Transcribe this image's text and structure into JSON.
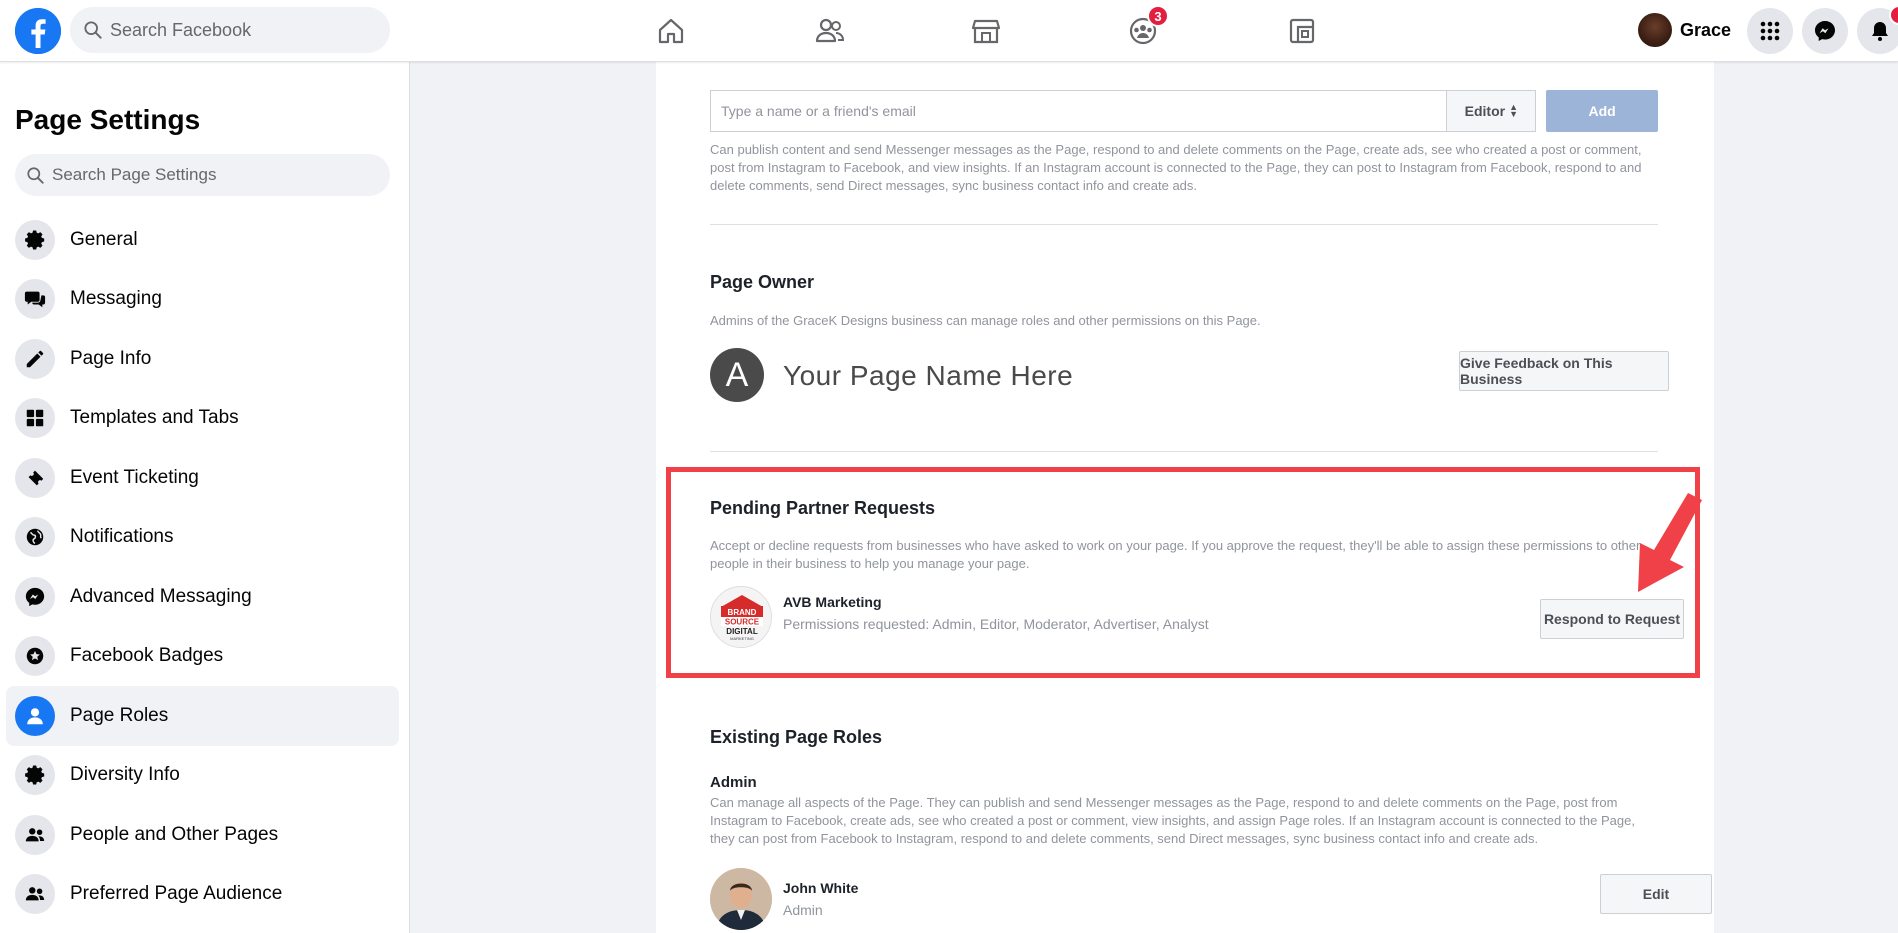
{
  "topbar": {
    "search_placeholder": "Search Facebook",
    "groups_badge": "3",
    "profile_name": "Grace"
  },
  "sidebar": {
    "title": "Page Settings",
    "search_placeholder": "Search Page Settings",
    "items": [
      {
        "label": "General",
        "icon": "gear-icon"
      },
      {
        "label": "Messaging",
        "icon": "chat-bubbles-icon"
      },
      {
        "label": "Page Info",
        "icon": "pencil-icon"
      },
      {
        "label": "Templates and Tabs",
        "icon": "grid-icon"
      },
      {
        "label": "Event Ticketing",
        "icon": "ticket-icon"
      },
      {
        "label": "Notifications",
        "icon": "globe-icon"
      },
      {
        "label": "Advanced Messaging",
        "icon": "messenger-icon"
      },
      {
        "label": "Facebook Badges",
        "icon": "star-badge-icon"
      },
      {
        "label": "Page Roles",
        "icon": "person-icon",
        "active": true
      },
      {
        "label": "Diversity Info",
        "icon": "gear-icon"
      },
      {
        "label": "People and Other Pages",
        "icon": "people-icon"
      },
      {
        "label": "Preferred Page Audience",
        "icon": "people-icon"
      }
    ]
  },
  "invite": {
    "placeholder": "Type a name or a friend's email",
    "role": "Editor",
    "add_label": "Add",
    "description": "Can publish content and send Messenger messages as the Page, respond to and delete comments on the Page, create ads, see who created a post or comment, post from Instagram to Facebook, and view insights. If an Instagram account is connected to the Page, they can post to Instagram from Facebook, respond to and delete comments, send Direct messages, sync business contact info and create ads."
  },
  "owner": {
    "title": "Page Owner",
    "description": "Admins of the GraceK Designs business can manage roles and other permissions on this Page.",
    "avatar_letter": "A",
    "page_name": "Your Page Name Here",
    "feedback_button": "Give Feedback on This Business"
  },
  "pending": {
    "title": "Pending Partner Requests",
    "description": "Accept or decline requests from businesses who have asked to work on your page. If you approve the request, they'll be able to assign these permissions to other people in their business to help you manage your page.",
    "partner_name": "AVB Marketing",
    "permissions": "Permissions requested: Admin, Editor, Moderator, Advertiser, Analyst",
    "respond_button": "Respond to Request",
    "logo_text": {
      "brand": "BRAND",
      "source": "SOURCE",
      "digital": "DIGITAL",
      "marketing": "MARKETING"
    }
  },
  "existing": {
    "title": "Existing Page Roles",
    "admin_label": "Admin",
    "admin_description": "Can manage all aspects of the Page. They can publish and send Messenger messages as the Page, respond to and delete comments on the Page, post from Instagram to Facebook, create ads, see who created a post or comment, view insights, and assign Page roles. If an Instagram account is connected to the Page, they can post from Facebook to Instagram, respond to and delete comments, send Direct messages, sync business contact info and create ads.",
    "person_name": "John White",
    "person_role": "Admin",
    "edit_button": "Edit"
  },
  "colors": {
    "facebook_blue": "#1877f2",
    "highlight_red": "#ef4147",
    "add_button_disabled": "#9cb4d8"
  }
}
